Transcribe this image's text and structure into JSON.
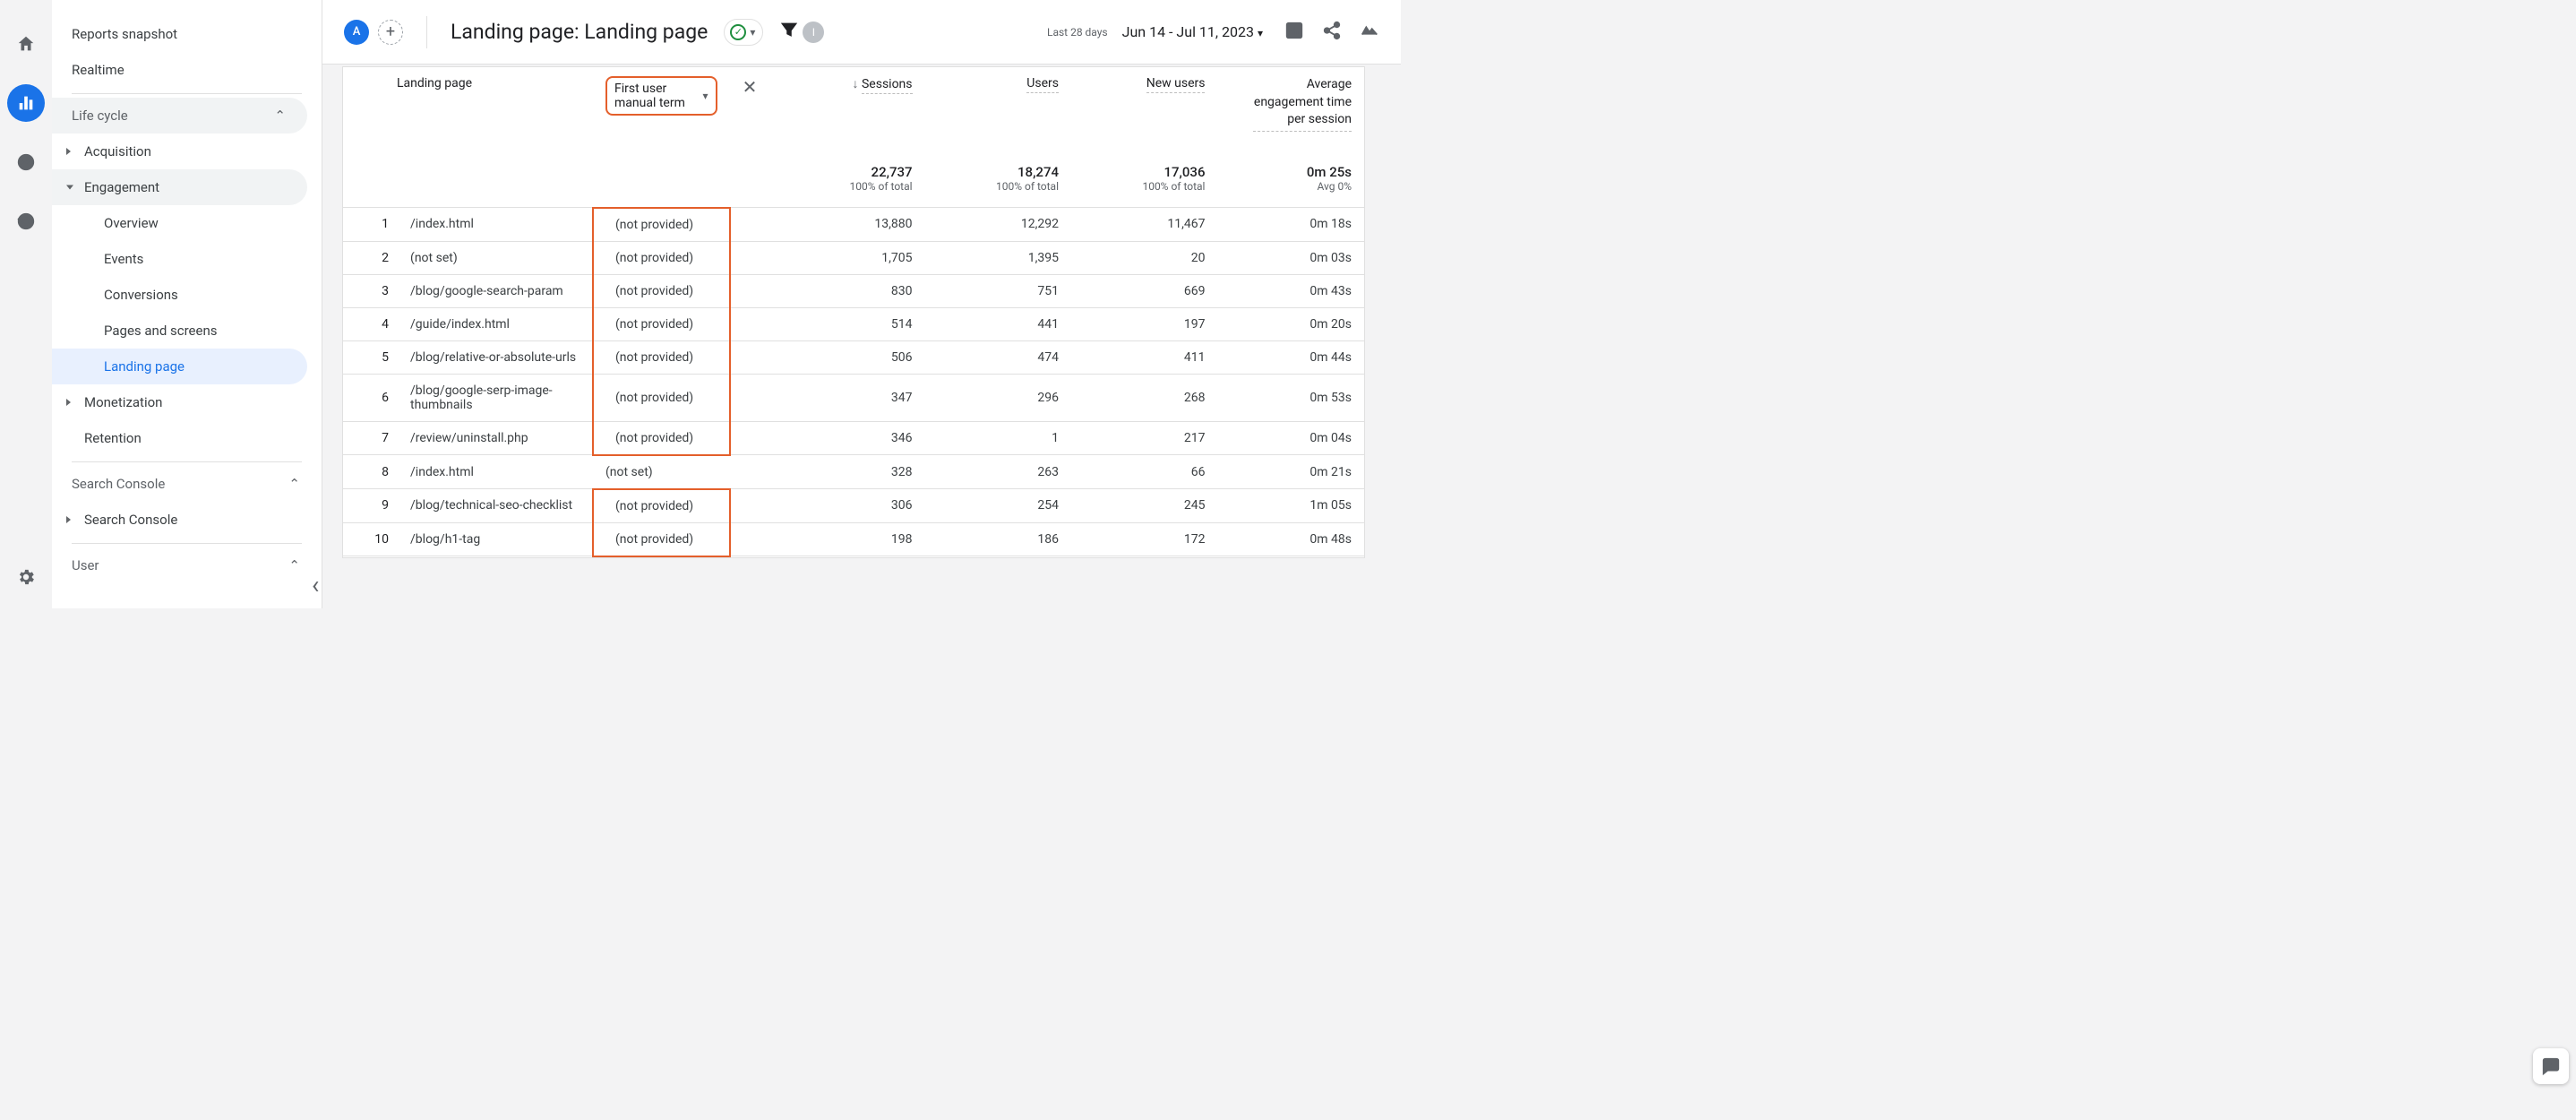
{
  "nav": {
    "reports_snapshot": "Reports snapshot",
    "realtime": "Realtime",
    "groups": {
      "lifecycle": "Life cycle",
      "search_console": "Search Console",
      "user": "User"
    },
    "lifecycle_items": {
      "acquisition": "Acquisition",
      "engagement": "Engagement",
      "monetization": "Monetization",
      "retention": "Retention"
    },
    "engagement_items": {
      "overview": "Overview",
      "events": "Events",
      "conversions": "Conversions",
      "pages_screens": "Pages and screens",
      "landing_page": "Landing page"
    },
    "sc_sub": "Search Console"
  },
  "header": {
    "avatar_letter": "A",
    "grey_letter": "I",
    "title": "Landing page: Landing page",
    "date_small": "Last 28 days",
    "date_main": "Jun 14 - Jul 11, 2023"
  },
  "table": {
    "dim1": "Landing page",
    "dim2": "First user manual term",
    "cols": {
      "sessions": "Sessions",
      "users": "Users",
      "new_users": "New users",
      "avg_eng": "Average engagement time per session"
    },
    "totals": {
      "sessions": "22,737",
      "users": "18,274",
      "new_users": "17,036",
      "avg_eng": "0m 25s",
      "sessions_sub": "100% of total",
      "users_sub": "100% of total",
      "new_users_sub": "100% of total",
      "avg_eng_sub": "Avg 0%"
    },
    "rows": [
      {
        "i": "1",
        "page": "/index.html",
        "term": "(not provided)",
        "sessions": "13,880",
        "users": "12,292",
        "new_users": "11,467",
        "eng": "0m 18s",
        "hl": true,
        "hltop": true
      },
      {
        "i": "2",
        "page": "(not set)",
        "term": "(not provided)",
        "sessions": "1,705",
        "users": "1,395",
        "new_users": "20",
        "eng": "0m 03s",
        "hl": true
      },
      {
        "i": "3",
        "page": "/blog/google-search-param",
        "term": "(not provided)",
        "sessions": "830",
        "users": "751",
        "new_users": "669",
        "eng": "0m 43s",
        "hl": true
      },
      {
        "i": "4",
        "page": "/guide/index.html",
        "term": "(not provided)",
        "sessions": "514",
        "users": "441",
        "new_users": "197",
        "eng": "0m 20s",
        "hl": true
      },
      {
        "i": "5",
        "page": "/blog/relative-or-absolute-urls",
        "term": "(not provided)",
        "sessions": "506",
        "users": "474",
        "new_users": "411",
        "eng": "0m 44s",
        "hl": true
      },
      {
        "i": "6",
        "page": "/blog/google-serp-image-thumbnails",
        "term": "(not provided)",
        "sessions": "347",
        "users": "296",
        "new_users": "268",
        "eng": "0m 53s",
        "hl": true
      },
      {
        "i": "7",
        "page": "/review/uninstall.php",
        "term": "(not provided)",
        "sessions": "346",
        "users": "1",
        "new_users": "217",
        "eng": "0m 04s",
        "hl": true,
        "hlbot": true
      },
      {
        "i": "8",
        "page": "/index.html",
        "term": "(not set)",
        "sessions": "328",
        "users": "263",
        "new_users": "66",
        "eng": "0m 21s",
        "hl": false
      },
      {
        "i": "9",
        "page": "/blog/technical-seo-checklist",
        "term": "(not provided)",
        "sessions": "306",
        "users": "254",
        "new_users": "245",
        "eng": "1m 05s",
        "hl": true,
        "hltop": true
      },
      {
        "i": "10",
        "page": "/blog/h1-tag",
        "term": "(not provided)",
        "sessions": "198",
        "users": "186",
        "new_users": "172",
        "eng": "0m 48s",
        "hl": true,
        "hlbot": true
      }
    ]
  }
}
